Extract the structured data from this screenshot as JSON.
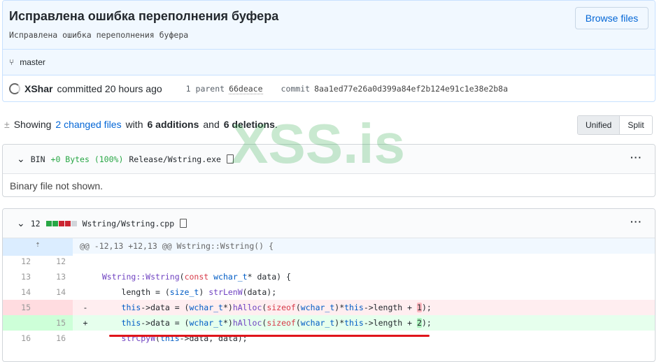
{
  "commit": {
    "title": "Исправлена ошибка переполнения буфера",
    "description": "Исправлена ошибка переполнения буфера",
    "browse_label": "Browse files",
    "branch": "master",
    "author": "XShar",
    "committed": "committed 20 hours ago",
    "parent_label": "1 parent",
    "parent_sha": "66deace",
    "commit_label": "commit",
    "commit_sha": "8aa1ed77e26a0d399a84ef2b124e91c1e38e2b8a"
  },
  "summary": {
    "showing": "Showing",
    "changed": "2 changed files",
    "with": "with",
    "additions": "6 additions",
    "and": "and",
    "deletions": "6 deletions",
    "period": "."
  },
  "view_toggle": {
    "unified": "Unified",
    "split": "Split",
    "selected": "Unified"
  },
  "watermark": "XSS.is",
  "files": [
    {
      "badge": "BIN",
      "stat": "+0 Bytes (100%)",
      "path": "Release/Wstring.exe",
      "body": "Binary file not shown.",
      "more": "···"
    },
    {
      "changes": "12",
      "bars": [
        "#28a745",
        "#28a745",
        "#cb2431",
        "#cb2431",
        "#d1d5da"
      ],
      "path": "Wstring/Wstring.cpp",
      "more": "···",
      "expand": "⇡",
      "hunk": "@@ -12,13 +12,13 @@ Wstring::Wstring() {",
      "lines": [
        {
          "type": "ctx",
          "old": "12",
          "new": "12",
          "sign": "",
          "tokens": []
        },
        {
          "type": "ctx",
          "old": "13",
          "new": "13",
          "sign": "",
          "tokens": [
            [
              "",
              "  "
            ],
            [
              "fn",
              "Wstring::Wstring"
            ],
            [
              "",
              "("
            ],
            [
              "kw",
              "const"
            ],
            [
              "ty",
              " wchar_t"
            ],
            [
              "",
              "* data) {"
            ]
          ]
        },
        {
          "type": "ctx",
          "old": "14",
          "new": "14",
          "sign": "",
          "tokens": [
            [
              "",
              "      length = ("
            ],
            [
              "ty",
              "size_t"
            ],
            [
              "",
              ") "
            ],
            [
              "fn",
              "strLenW"
            ],
            [
              "",
              "(data);"
            ]
          ]
        },
        {
          "type": "del",
          "old": "15",
          "new": "",
          "sign": "-",
          "tokens": [
            [
              "",
              "      "
            ],
            [
              "ty",
              "this"
            ],
            [
              "",
              "->data = ("
            ],
            [
              "ty",
              "wchar_t"
            ],
            [
              "",
              "*)"
            ],
            [
              "fn",
              "hAlloc"
            ],
            [
              "",
              "("
            ],
            [
              "kw",
              "sizeof"
            ],
            [
              "",
              "("
            ],
            [
              "ty",
              "wchar_t"
            ],
            [
              "",
              ")*"
            ],
            [
              "ty",
              "this"
            ],
            [
              "",
              "->length + "
            ],
            [
              "hd",
              "1"
            ],
            [
              "",
              ");"
            ]
          ]
        },
        {
          "type": "add",
          "old": "",
          "new": "15",
          "sign": "+",
          "tokens": [
            [
              "",
              "      "
            ],
            [
              "ty",
              "this"
            ],
            [
              "",
              "->data = ("
            ],
            [
              "ty",
              "wchar_t"
            ],
            [
              "",
              "*)"
            ],
            [
              "fn",
              "hAlloc"
            ],
            [
              "",
              "("
            ],
            [
              "kw",
              "sizeof"
            ],
            [
              "",
              "("
            ],
            [
              "ty",
              "wchar_t"
            ],
            [
              "",
              ")*"
            ],
            [
              "ty",
              "this"
            ],
            [
              "",
              "->length + "
            ],
            [
              "ha",
              "2"
            ],
            [
              "",
              ");"
            ]
          ]
        },
        {
          "type": "ctx",
          "old": "16",
          "new": "16",
          "sign": "",
          "tokens": [
            [
              "",
              "      "
            ],
            [
              "fn",
              "strCpyW"
            ],
            [
              "",
              "("
            ],
            [
              "ty",
              "this"
            ],
            [
              "",
              "->data, data);"
            ]
          ]
        }
      ]
    }
  ],
  "colors": {
    "accent": "#0366d6",
    "annotation": "#e0151b"
  }
}
